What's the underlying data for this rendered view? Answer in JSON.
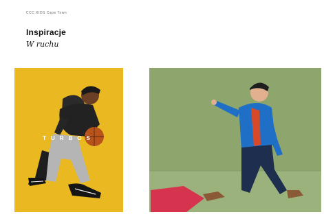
{
  "header": {
    "kicker": "CCC KIDS Cape Town",
    "title": "Inspiracje",
    "subtitle": "W ruchu"
  },
  "cards": [
    {
      "overlay_text": "TURBOS",
      "background": "#e9b61c"
    },
    {
      "background": "#8fa56e"
    }
  ],
  "colors": {
    "yellow": "#e9b61c",
    "green": "#8fa56e",
    "jacket_blue": "#1f6fc7",
    "pink": "#d6334f"
  }
}
